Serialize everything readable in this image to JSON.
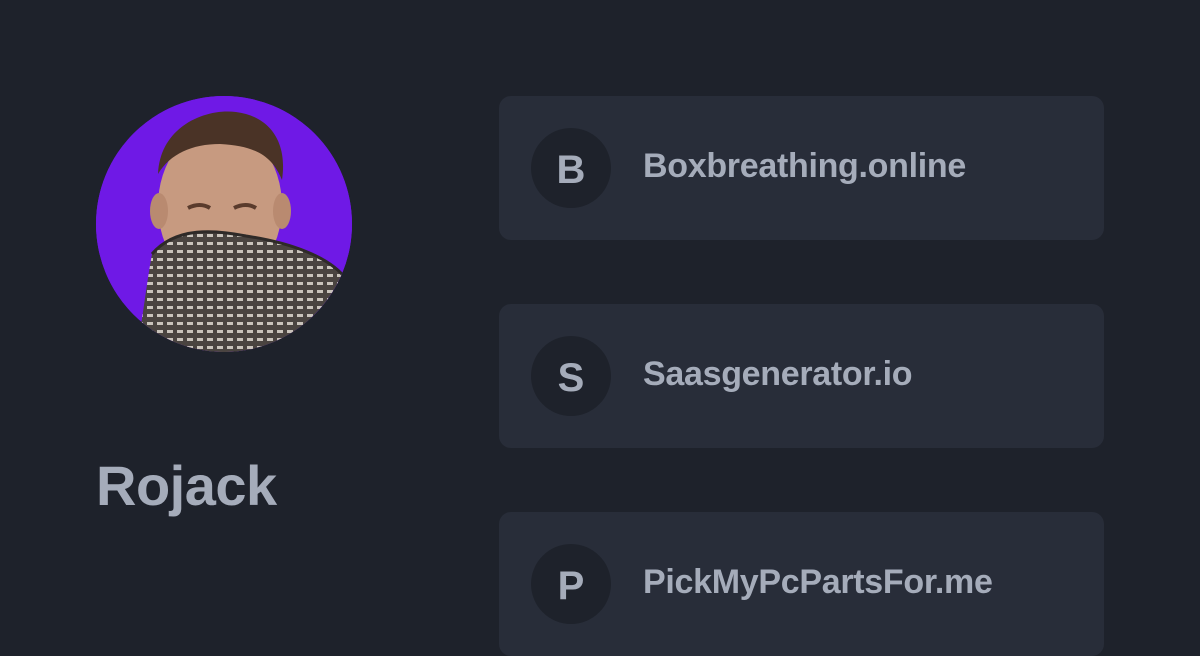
{
  "profile": {
    "name": "Rojack",
    "avatar_background": "#6f19e6"
  },
  "links": [
    {
      "letter": "B",
      "title": "Boxbreathing.online"
    },
    {
      "letter": "S",
      "title": "Saasgenerator.io"
    },
    {
      "letter": "P",
      "title": "PickMyPcPartsFor.me"
    }
  ],
  "colors": {
    "background": "#1e222b",
    "card": "#282d39",
    "text": "#a5acba"
  }
}
